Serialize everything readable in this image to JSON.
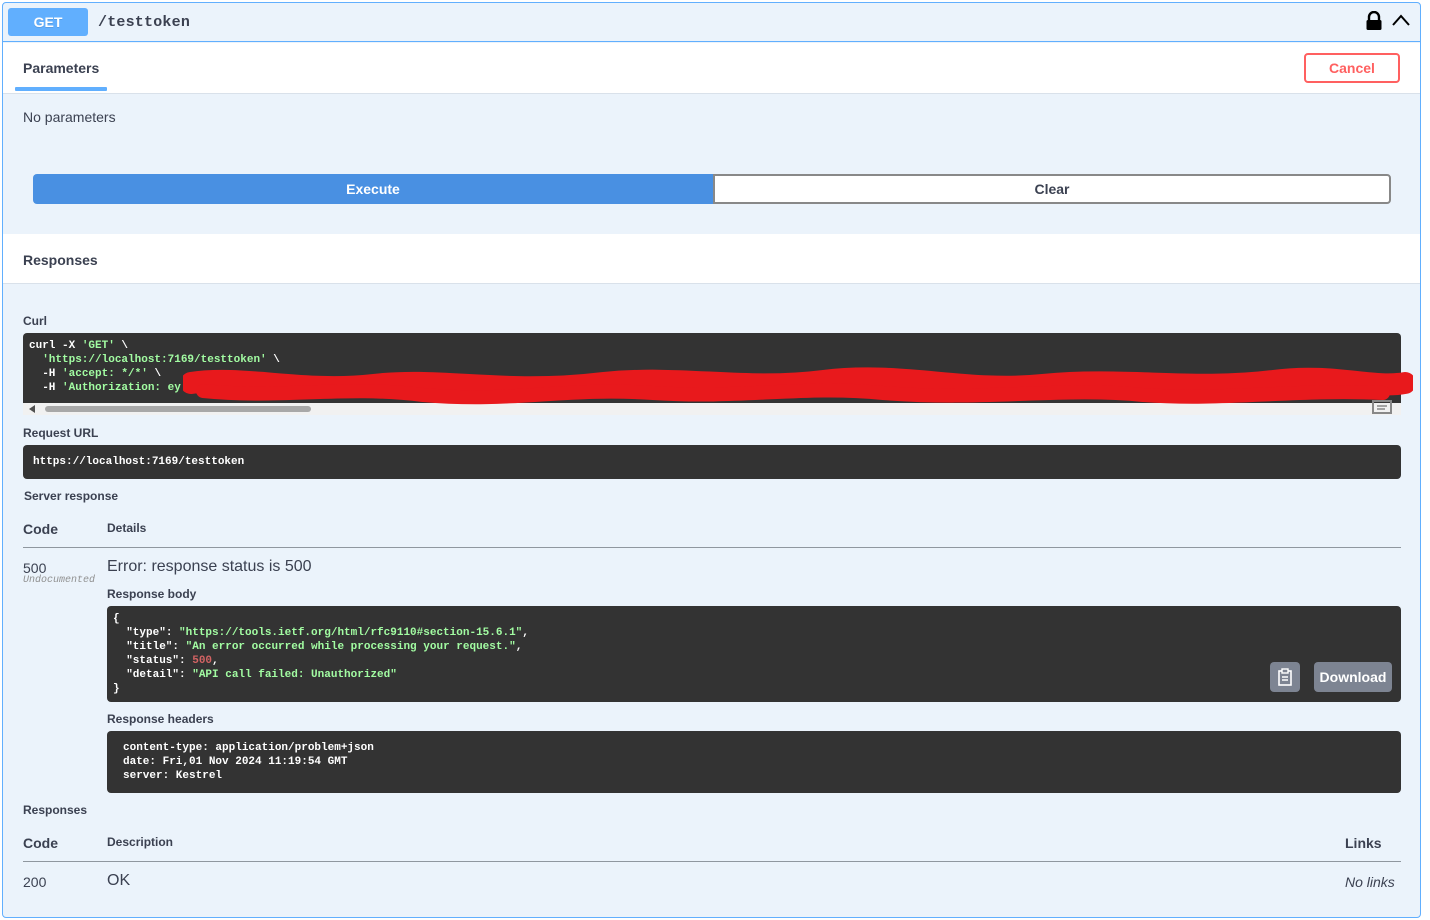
{
  "operation": {
    "method": "GET",
    "path": "/testtoken"
  },
  "params": {
    "tab_label": "Parameters",
    "cancel_label": "Cancel",
    "no_params": "No parameters",
    "execute_label": "Execute",
    "clear_label": "Clear"
  },
  "responses_section": {
    "title": "Responses"
  },
  "curl": {
    "label": "Curl",
    "line1_cmd": "curl -X ",
    "line1_str": "'GET'",
    "line1_end": " \\",
    "line2_str": "'https://localhost:7169/testtoken'",
    "line2_end": " \\",
    "line3_cmd": "-H ",
    "line3_str": "'accept: */*'",
    "line3_end": " \\",
    "line4_cmd": "-H ",
    "line4_str": "'Authorization: ey"
  },
  "request_url": {
    "label": "Request URL",
    "value": "https://localhost:7169/testtoken"
  },
  "server_response": {
    "label": "Server response",
    "col_code": "Code",
    "col_details": "Details",
    "code": "500",
    "code_note": "Undocumented",
    "error_text": "Error: response status is 500",
    "body_label": "Response body",
    "body": {
      "open": "{",
      "type_key": "\"type\"",
      "type_val": "\"https://tools.ietf.org/html/rfc9110#section-15.6.1\"",
      "title_key": "\"title\"",
      "title_val": "\"An error occurred while processing your request.\"",
      "status_key": "\"status\"",
      "status_val": "500",
      "detail_key": "\"detail\"",
      "detail_val": "\"API call failed: Unauthorized\"",
      "close": "}"
    },
    "download_label": "Download",
    "headers_label": "Response headers",
    "headers": [
      "content-type: application/problem+json",
      "date: Fri,01 Nov 2024 11:19:54 GMT",
      "server: Kestrel"
    ]
  },
  "responses_table": {
    "label": "Responses",
    "col_code": "Code",
    "col_description": "Description",
    "col_links": "Links",
    "rows": [
      {
        "code": "200",
        "description": "OK",
        "links": "No links"
      }
    ]
  },
  "colors": {
    "get_blue": "#61affe",
    "execute_blue": "#4990e2",
    "cancel_red": "#ff6060",
    "code_bg": "#333333",
    "string_green": "#a2fca2",
    "number_red": "#d36363",
    "redaction_red": "#e8191c"
  }
}
